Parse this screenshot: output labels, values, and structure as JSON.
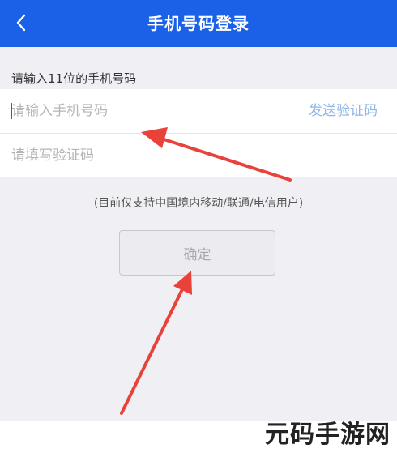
{
  "header": {
    "title": "手机号码登录",
    "back_icon": "chevron-left-icon",
    "color": "#1a61e8"
  },
  "form": {
    "section_label": "请输入11位的手机号码",
    "phone_placeholder": "请输入手机号码",
    "send_code_label": "发送验证码",
    "code_placeholder": "请填写验证码",
    "support_note": "(目前仅支持中国境内移动/联通/电信用户)",
    "confirm_label": "确定"
  },
  "annotations": {
    "arrow_color": "#e8423a"
  },
  "watermark": {
    "text": "元码手游网"
  }
}
